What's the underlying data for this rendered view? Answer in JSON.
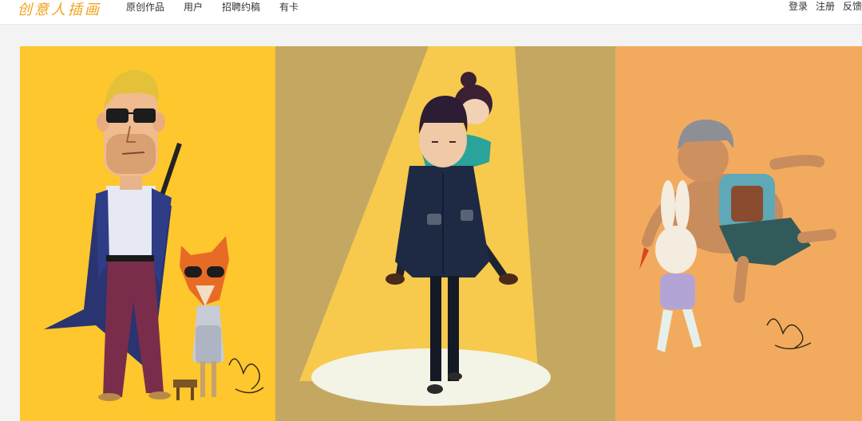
{
  "header": {
    "logo_text": "创意人插画",
    "nav": [
      "原创作品",
      "用户",
      "招聘约稿",
      "有卡"
    ],
    "auth": [
      "登录",
      "注册",
      "反馈"
    ]
  },
  "banner": {
    "panels": [
      {
        "name": "left",
        "bg": "#fdc72d"
      },
      {
        "name": "center",
        "bg": "#c4a862",
        "light": "#f7c94d"
      },
      {
        "name": "right",
        "bg": "#f2ab5e"
      }
    ]
  },
  "colors": {
    "accent": "#f0a21b",
    "page_bg": "#f3f3f3"
  }
}
